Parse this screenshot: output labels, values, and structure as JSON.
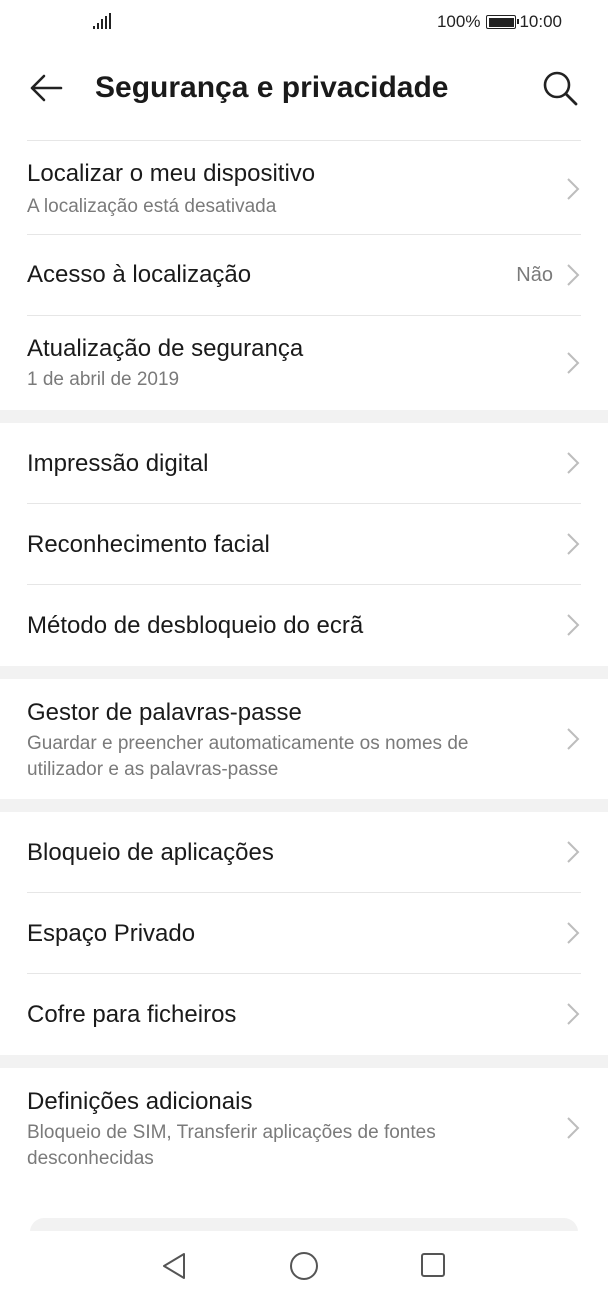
{
  "status": {
    "battery_text": "100%",
    "time": "10:00"
  },
  "header": {
    "title": "Segurança e privacidade"
  },
  "items": {
    "find_device": {
      "label": "Localizar o meu dispositivo",
      "sub": "A localização está desativada"
    },
    "location_access": {
      "label": "Acesso à localização",
      "value": "Não"
    },
    "security_update": {
      "label": "Atualização de segurança",
      "sub": "1 de abril de 2019"
    },
    "fingerprint": {
      "label": "Impressão digital"
    },
    "face_recognition": {
      "label": "Reconhecimento facial"
    },
    "unlock_method": {
      "label": "Método de desbloqueio do ecrã"
    },
    "password_manager": {
      "label": "Gestor de palavras-passe",
      "sub": "Guardar e preencher automaticamente os nomes de utilizador e as palavras-passe"
    },
    "app_lock": {
      "label": "Bloqueio de aplicações"
    },
    "private_space": {
      "label": "Espaço Privado"
    },
    "file_safe": {
      "label": "Cofre para ficheiros"
    },
    "additional_settings": {
      "label": "Definições adicionais",
      "sub": "Bloqueio de SIM, Transferir aplicações de fontes desconhecidas"
    }
  },
  "icons": {
    "back": "arrow-left-icon",
    "search": "search-icon",
    "chevron": "chevron-right-icon",
    "nav_back": "triangle-back-icon",
    "nav_home": "circle-home-icon",
    "nav_recents": "square-recents-icon"
  }
}
